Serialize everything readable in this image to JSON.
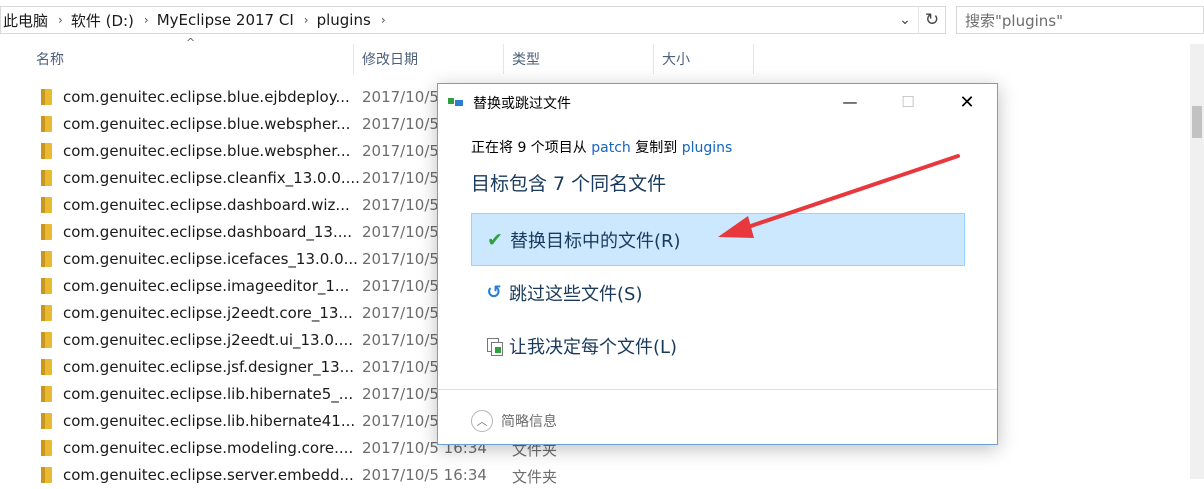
{
  "address_bar": {
    "crumbs": [
      "此电脑",
      "软件 (D:)",
      "MyEclipse 2017 CI",
      "plugins"
    ],
    "separator": "›",
    "dropdown_glyph": "⌄",
    "refresh_glyph": "↻"
  },
  "search": {
    "placeholder": "搜索\"plugins\""
  },
  "columns": {
    "name": "名称",
    "modified": "修改日期",
    "type": "类型",
    "size": "大小"
  },
  "files": [
    {
      "name": "com.genuitec.eclipse.blue.ejbdeploy...",
      "modified": "2017/10/5",
      "type": ""
    },
    {
      "name": "com.genuitec.eclipse.blue.webspher...",
      "modified": "2017/10/5",
      "type": ""
    },
    {
      "name": "com.genuitec.eclipse.blue.webspher...",
      "modified": "2017/10/5",
      "type": ""
    },
    {
      "name": "com.genuitec.eclipse.cleanfix_13.0.0....",
      "modified": "2017/10/5",
      "type": ""
    },
    {
      "name": "com.genuitec.eclipse.dashboard.wiz...",
      "modified": "2017/10/5",
      "type": ""
    },
    {
      "name": "com.genuitec.eclipse.dashboard_13....",
      "modified": "2017/10/5",
      "type": ""
    },
    {
      "name": "com.genuitec.eclipse.icefaces_13.0.0...",
      "modified": "2017/10/5",
      "type": ""
    },
    {
      "name": "com.genuitec.eclipse.imageeditor_1...",
      "modified": "2017/10/5",
      "type": ""
    },
    {
      "name": "com.genuitec.eclipse.j2eedt.core_13...",
      "modified": "2017/10/5",
      "type": ""
    },
    {
      "name": "com.genuitec.eclipse.j2eedt.ui_13.0....",
      "modified": "2017/10/5",
      "type": ""
    },
    {
      "name": "com.genuitec.eclipse.jsf.designer_13...",
      "modified": "2017/10/5",
      "type": ""
    },
    {
      "name": "com.genuitec.eclipse.lib.hibernate5_...",
      "modified": "2017/10/5",
      "type": ""
    },
    {
      "name": "com.genuitec.eclipse.lib.hibernate41...",
      "modified": "2017/10/5",
      "type": ""
    },
    {
      "name": "com.genuitec.eclipse.modeling.core....",
      "modified": "2017/10/5 16:34",
      "type": "文件夹"
    },
    {
      "name": "com.genuitec.eclipse.server.embedd...",
      "modified": "2017/10/5 16:34",
      "type": "文件夹"
    }
  ],
  "dialog": {
    "title": "替换或跳过文件",
    "min_glyph": "—",
    "max_glyph": "☐",
    "close_glyph": "✕",
    "line1": {
      "prefix": "正在将 9 个项目从 ",
      "source": "patch",
      "middle": " 复制到 ",
      "dest": "plugins"
    },
    "line2": "目标包含 7 个同名文件",
    "options": {
      "replace": "替换目标中的文件(R)",
      "skip": "跳过这些文件(S)",
      "decide": "让我决定每个文件(L)"
    },
    "details": "简略信息"
  },
  "colors": {
    "selection_bg": "#cce8ff",
    "selection_border": "#99d1ff",
    "link": "#1565c0",
    "arrow": "#e8383d"
  }
}
